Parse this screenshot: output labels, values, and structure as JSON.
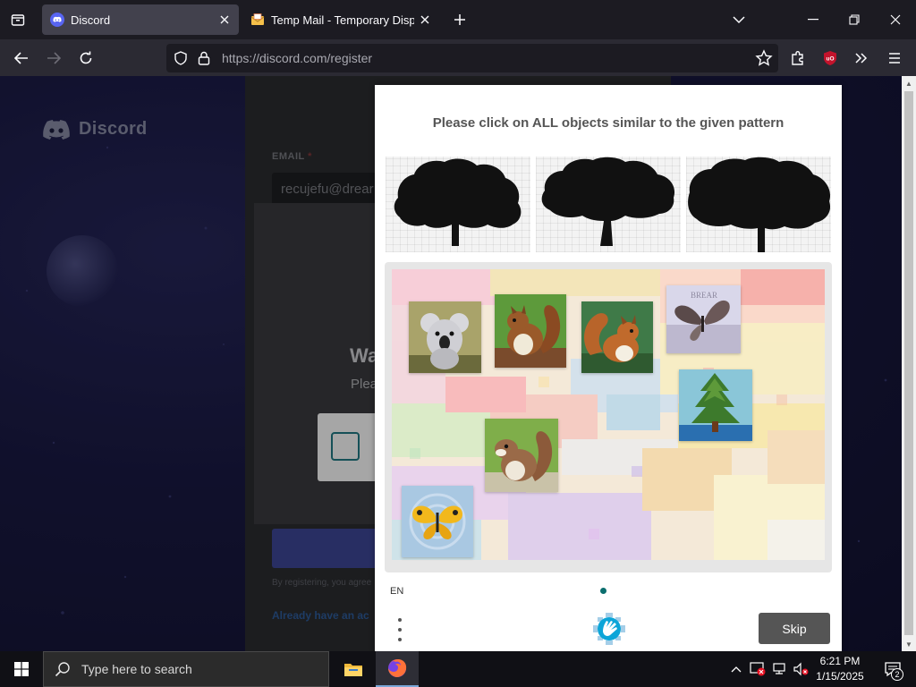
{
  "browser": {
    "tabs": [
      {
        "title": "Discord",
        "active": true
      },
      {
        "title": "Temp Mail - Temporary Disposa",
        "active": false
      }
    ],
    "url": {
      "host": "https://discord.com",
      "path": "/register"
    }
  },
  "page": {
    "brand": "Discord",
    "email_label": "EMAIL",
    "email_required_mark": "*",
    "email_value": "recujefu@drear",
    "modal_heading_fragment": "Wa",
    "modal_text_fragment": "Plea",
    "terms_fragment": "By registering, you agree",
    "login_link_fragment": "Already have an ac"
  },
  "captcha": {
    "prompt": "Please click on ALL objects similar to the given pattern",
    "language": "EN",
    "skip_label": "Skip",
    "example_count": 3,
    "objects": [
      "koala",
      "squirrel",
      "squirrel",
      "butterfly",
      "tree",
      "squirrel",
      "butterfly"
    ]
  },
  "taskbar": {
    "search_placeholder": "Type here to search",
    "time": "6:21 PM",
    "date": "1/15/2025",
    "notification_count": "2"
  },
  "colors": {
    "accent_teal": "#0b6e6e",
    "discord_blurple": "#5865f2",
    "skip_button": "#555555"
  }
}
